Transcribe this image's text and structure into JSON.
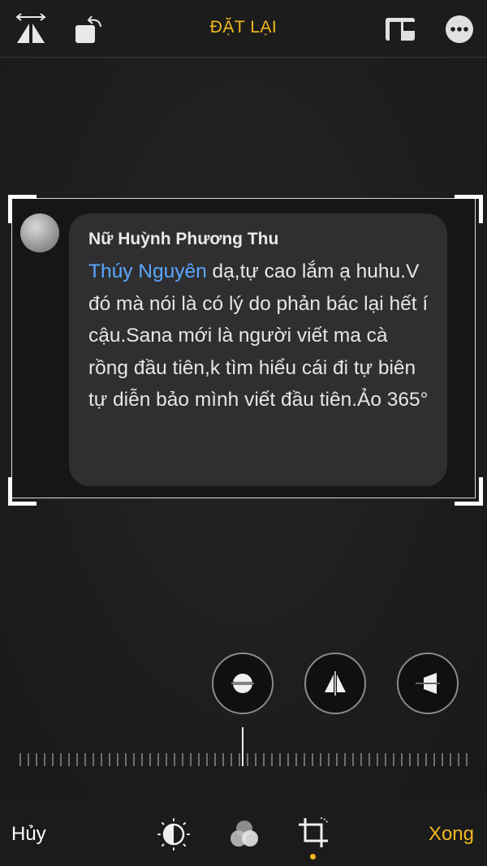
{
  "header": {
    "reset_label": "ĐẶT LẠI",
    "icons": [
      "flip-horizontal-icon",
      "rotate-icon",
      "aspect-ratio-icon",
      "more-icon"
    ]
  },
  "comment": {
    "author": "Nữ Huỳnh Phương Thu",
    "mention": "Thúy Nguyên",
    "text": " dạ,tự cao lắm ạ huhu.V đó mà nói là có lý do phản bác lại hết í cậu.Sana mới là người viết ma cà rồng đầu tiên,k tìm hiểu cái đi tự biên tự diễn bảo mình viết đầu tiên.Ảo 365°"
  },
  "adjust_buttons": [
    "straighten-icon",
    "vertical-perspective-icon",
    "horizontal-perspective-icon"
  ],
  "footer": {
    "cancel_label": "Hủy",
    "done_label": "Xong",
    "tools": [
      "adjust-icon",
      "filters-icon",
      "crop-icon"
    ],
    "active_tool": "crop-icon"
  },
  "colors": {
    "accent": "#f2b81f",
    "mention": "#5aa7ff",
    "bubble": "#2f2f31"
  }
}
